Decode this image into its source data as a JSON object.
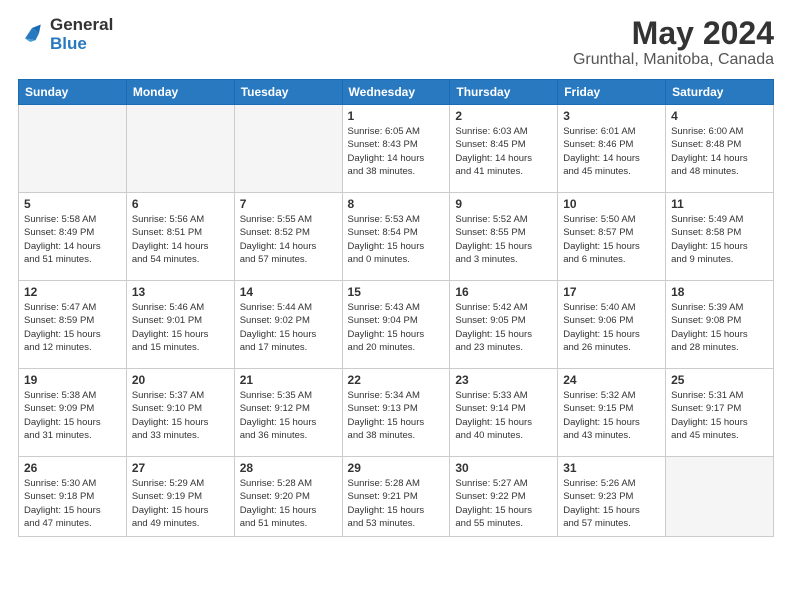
{
  "header": {
    "logo_line1": "General",
    "logo_line2": "Blue",
    "title": "May 2024",
    "subtitle": "Grunthal, Manitoba, Canada"
  },
  "days": [
    "Sunday",
    "Monday",
    "Tuesday",
    "Wednesday",
    "Thursday",
    "Friday",
    "Saturday"
  ],
  "weeks": [
    [
      {
        "date": "",
        "info": ""
      },
      {
        "date": "",
        "info": ""
      },
      {
        "date": "",
        "info": ""
      },
      {
        "date": "1",
        "info": "Sunrise: 6:05 AM\nSunset: 8:43 PM\nDaylight: 14 hours\nand 38 minutes."
      },
      {
        "date": "2",
        "info": "Sunrise: 6:03 AM\nSunset: 8:45 PM\nDaylight: 14 hours\nand 41 minutes."
      },
      {
        "date": "3",
        "info": "Sunrise: 6:01 AM\nSunset: 8:46 PM\nDaylight: 14 hours\nand 45 minutes."
      },
      {
        "date": "4",
        "info": "Sunrise: 6:00 AM\nSunset: 8:48 PM\nDaylight: 14 hours\nand 48 minutes."
      }
    ],
    [
      {
        "date": "5",
        "info": "Sunrise: 5:58 AM\nSunset: 8:49 PM\nDaylight: 14 hours\nand 51 minutes."
      },
      {
        "date": "6",
        "info": "Sunrise: 5:56 AM\nSunset: 8:51 PM\nDaylight: 14 hours\nand 54 minutes."
      },
      {
        "date": "7",
        "info": "Sunrise: 5:55 AM\nSunset: 8:52 PM\nDaylight: 14 hours\nand 57 minutes."
      },
      {
        "date": "8",
        "info": "Sunrise: 5:53 AM\nSunset: 8:54 PM\nDaylight: 15 hours\nand 0 minutes."
      },
      {
        "date": "9",
        "info": "Sunrise: 5:52 AM\nSunset: 8:55 PM\nDaylight: 15 hours\nand 3 minutes."
      },
      {
        "date": "10",
        "info": "Sunrise: 5:50 AM\nSunset: 8:57 PM\nDaylight: 15 hours\nand 6 minutes."
      },
      {
        "date": "11",
        "info": "Sunrise: 5:49 AM\nSunset: 8:58 PM\nDaylight: 15 hours\nand 9 minutes."
      }
    ],
    [
      {
        "date": "12",
        "info": "Sunrise: 5:47 AM\nSunset: 8:59 PM\nDaylight: 15 hours\nand 12 minutes."
      },
      {
        "date": "13",
        "info": "Sunrise: 5:46 AM\nSunset: 9:01 PM\nDaylight: 15 hours\nand 15 minutes."
      },
      {
        "date": "14",
        "info": "Sunrise: 5:44 AM\nSunset: 9:02 PM\nDaylight: 15 hours\nand 17 minutes."
      },
      {
        "date": "15",
        "info": "Sunrise: 5:43 AM\nSunset: 9:04 PM\nDaylight: 15 hours\nand 20 minutes."
      },
      {
        "date": "16",
        "info": "Sunrise: 5:42 AM\nSunset: 9:05 PM\nDaylight: 15 hours\nand 23 minutes."
      },
      {
        "date": "17",
        "info": "Sunrise: 5:40 AM\nSunset: 9:06 PM\nDaylight: 15 hours\nand 26 minutes."
      },
      {
        "date": "18",
        "info": "Sunrise: 5:39 AM\nSunset: 9:08 PM\nDaylight: 15 hours\nand 28 minutes."
      }
    ],
    [
      {
        "date": "19",
        "info": "Sunrise: 5:38 AM\nSunset: 9:09 PM\nDaylight: 15 hours\nand 31 minutes."
      },
      {
        "date": "20",
        "info": "Sunrise: 5:37 AM\nSunset: 9:10 PM\nDaylight: 15 hours\nand 33 minutes."
      },
      {
        "date": "21",
        "info": "Sunrise: 5:35 AM\nSunset: 9:12 PM\nDaylight: 15 hours\nand 36 minutes."
      },
      {
        "date": "22",
        "info": "Sunrise: 5:34 AM\nSunset: 9:13 PM\nDaylight: 15 hours\nand 38 minutes."
      },
      {
        "date": "23",
        "info": "Sunrise: 5:33 AM\nSunset: 9:14 PM\nDaylight: 15 hours\nand 40 minutes."
      },
      {
        "date": "24",
        "info": "Sunrise: 5:32 AM\nSunset: 9:15 PM\nDaylight: 15 hours\nand 43 minutes."
      },
      {
        "date": "25",
        "info": "Sunrise: 5:31 AM\nSunset: 9:17 PM\nDaylight: 15 hours\nand 45 minutes."
      }
    ],
    [
      {
        "date": "26",
        "info": "Sunrise: 5:30 AM\nSunset: 9:18 PM\nDaylight: 15 hours\nand 47 minutes."
      },
      {
        "date": "27",
        "info": "Sunrise: 5:29 AM\nSunset: 9:19 PM\nDaylight: 15 hours\nand 49 minutes."
      },
      {
        "date": "28",
        "info": "Sunrise: 5:28 AM\nSunset: 9:20 PM\nDaylight: 15 hours\nand 51 minutes."
      },
      {
        "date": "29",
        "info": "Sunrise: 5:28 AM\nSunset: 9:21 PM\nDaylight: 15 hours\nand 53 minutes."
      },
      {
        "date": "30",
        "info": "Sunrise: 5:27 AM\nSunset: 9:22 PM\nDaylight: 15 hours\nand 55 minutes."
      },
      {
        "date": "31",
        "info": "Sunrise: 5:26 AM\nSunset: 9:23 PM\nDaylight: 15 hours\nand 57 minutes."
      },
      {
        "date": "",
        "info": ""
      }
    ]
  ]
}
